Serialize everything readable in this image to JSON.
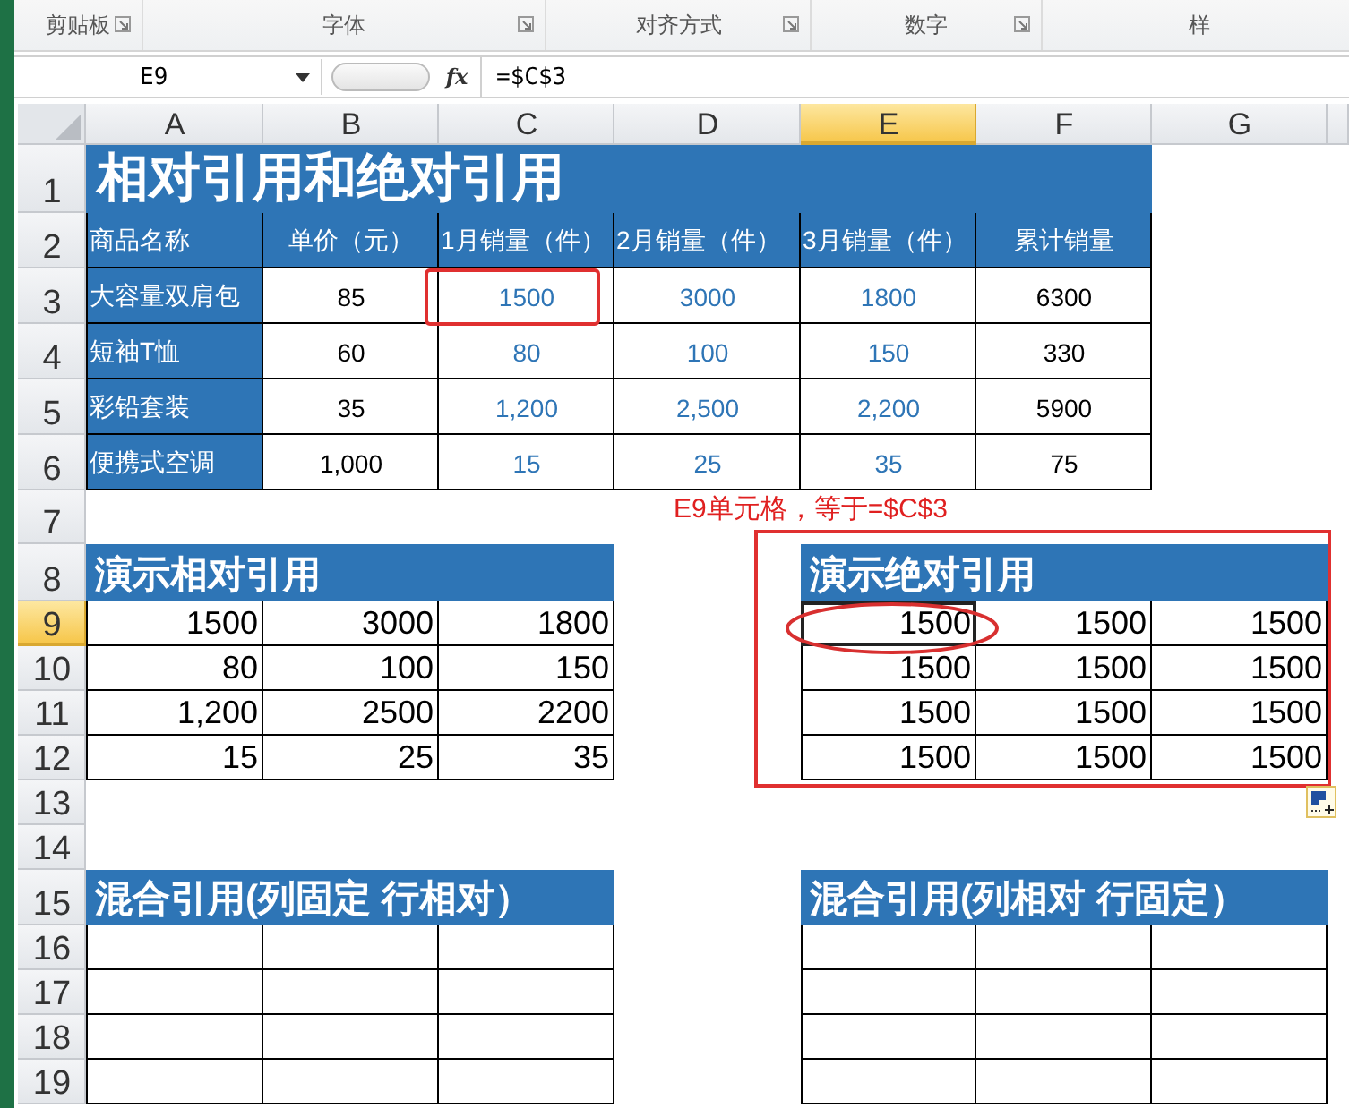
{
  "ribbon_groups": [
    {
      "label": "剪贴板",
      "launcher": true
    },
    {
      "label": "字体",
      "launcher": true
    },
    {
      "label": "对齐方式",
      "launcher": true
    },
    {
      "label": "数字",
      "launcher": true
    },
    {
      "label": "样",
      "launcher": false
    }
  ],
  "formula_bar": {
    "name_box": "E9",
    "function_button": "fx",
    "formula": "=$C$3"
  },
  "columns": [
    {
      "label": "A",
      "selected": false
    },
    {
      "label": "B",
      "selected": false
    },
    {
      "label": "C",
      "selected": false
    },
    {
      "label": "D",
      "selected": false
    },
    {
      "label": "E",
      "selected": true
    },
    {
      "label": "F",
      "selected": false
    },
    {
      "label": "G",
      "selected": false
    }
  ],
  "rows": [
    {
      "label": "1",
      "selected": false
    },
    {
      "label": "2",
      "selected": false
    },
    {
      "label": "3",
      "selected": false
    },
    {
      "label": "4",
      "selected": false
    },
    {
      "label": "5",
      "selected": false
    },
    {
      "label": "6",
      "selected": false
    },
    {
      "label": "7",
      "selected": false
    },
    {
      "label": "8",
      "selected": false
    },
    {
      "label": "9",
      "selected": true
    },
    {
      "label": "10",
      "selected": false
    },
    {
      "label": "11",
      "selected": false
    },
    {
      "label": "12",
      "selected": false
    },
    {
      "label": "13",
      "selected": false
    },
    {
      "label": "14",
      "selected": false
    },
    {
      "label": "15",
      "selected": false
    },
    {
      "label": "16",
      "selected": false
    },
    {
      "label": "17",
      "selected": false
    },
    {
      "label": "18",
      "selected": false
    },
    {
      "label": "19",
      "selected": false
    }
  ],
  "sales_table": {
    "title": "相对引用和绝对引用",
    "headers": [
      {
        "label": "商品名称",
        "kind": "name"
      },
      {
        "label": "单价（元）",
        "kind": "price"
      },
      {
        "label": "1月销量（件）",
        "kind": "sales"
      },
      {
        "label": "2月销量（件）",
        "kind": "sales"
      },
      {
        "label": "3月销量（件）",
        "kind": "sales"
      },
      {
        "label": "累计销量",
        "kind": "total"
      }
    ],
    "rows": [
      [
        "大容量双肩包",
        "85",
        "1500",
        "3000",
        "1800",
        "6300"
      ],
      [
        "短袖T恤",
        "60",
        "80",
        "100",
        "150",
        "330"
      ],
      [
        "彩铅套装",
        "35",
        "1,200",
        "2,500",
        "2,200",
        "5900"
      ],
      [
        "便携式空调",
        "1,000",
        "15",
        "25",
        "35",
        "75"
      ]
    ]
  },
  "note": "E9单元格，等于=$C$3",
  "relative_demo": {
    "title": "演示相对引用",
    "rows": [
      [
        "1500",
        "3000",
        "1800"
      ],
      [
        "80",
        "100",
        "150"
      ],
      [
        "1,200",
        "2500",
        "2200"
      ],
      [
        "15",
        "25",
        "35"
      ]
    ]
  },
  "absolute_demo": {
    "title": "演示绝对引用",
    "rows": [
      [
        {
          "text": "1500",
          "selected": true
        },
        {
          "text": "1500",
          "selected": false
        },
        {
          "text": "1500",
          "selected": false
        }
      ],
      [
        {
          "text": "1500",
          "selected": false
        },
        {
          "text": "1500",
          "selected": false
        },
        {
          "text": "1500",
          "selected": false
        }
      ],
      [
        {
          "text": "1500",
          "selected": false
        },
        {
          "text": "1500",
          "selected": false
        },
        {
          "text": "1500",
          "selected": false
        }
      ],
      [
        {
          "text": "1500",
          "selected": false
        },
        {
          "text": "1500",
          "selected": false
        },
        {
          "text": "1500",
          "selected": false
        }
      ]
    ]
  },
  "mixed_column_fixed": {
    "title": "混合引用(列固定 行相对）"
  },
  "mixed_row_fixed": {
    "title": "混合引用(列相对 行固定）"
  }
}
